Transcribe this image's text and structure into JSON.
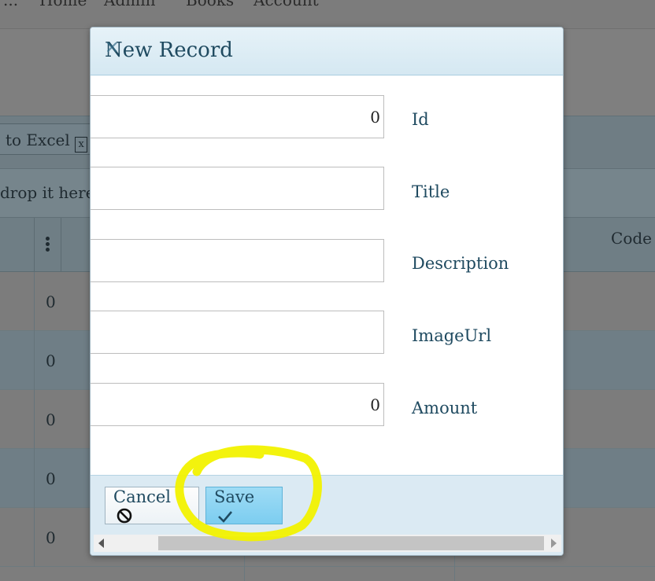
{
  "background": {
    "nav": [
      "...",
      "Home",
      "Admin",
      "Books",
      "Account"
    ],
    "export_label": "to Excel",
    "export_icon": "excel-icon",
    "group_hint": "drop it here",
    "grid_header": {
      "code_column": "Code"
    },
    "rows": [
      "0",
      "0",
      "0",
      "0",
      "0"
    ]
  },
  "dialog": {
    "title": "New Record",
    "close_icon": "close-icon",
    "fields": [
      {
        "label": "Id",
        "value": "0"
      },
      {
        "label": "Title",
        "value": ""
      },
      {
        "label": "Description",
        "value": ""
      },
      {
        "label": "ImageUrl",
        "value": ""
      },
      {
        "label": "Amount",
        "value": "0"
      }
    ],
    "buttons": {
      "cancel_label": "Cancel",
      "cancel_icon": "cancel-icon",
      "save_label": "Save",
      "save_icon": "checkmark-icon"
    }
  },
  "colors": {
    "dialog_header_text": "#1f4a60",
    "save_button_bg": "#8fd5f3",
    "footer_bg": "#dbeaf3",
    "highlight": "#f2f200"
  }
}
